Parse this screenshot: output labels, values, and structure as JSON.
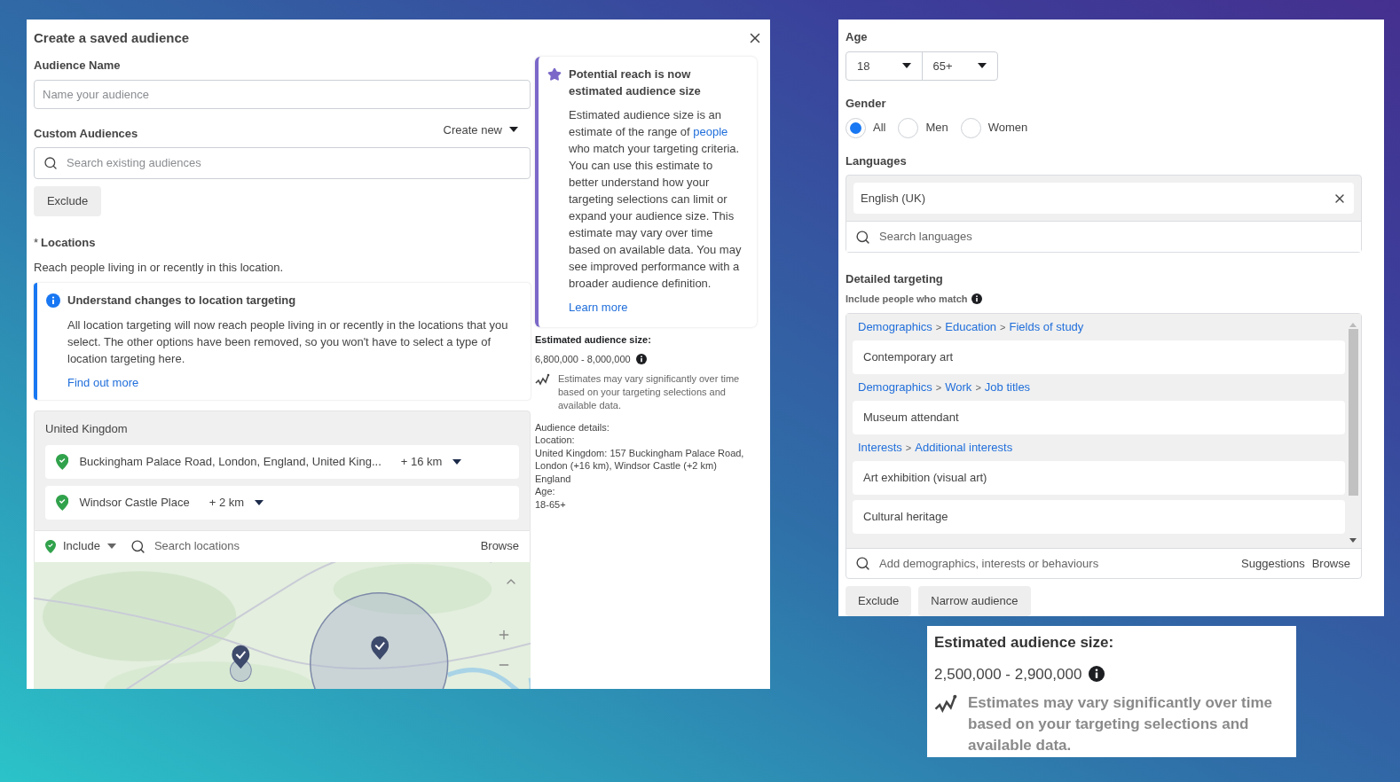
{
  "dialog": {
    "title": "Create a saved audience",
    "audience_name": {
      "label": "Audience Name",
      "placeholder": "Name your audience"
    },
    "custom_audiences": {
      "label": "Custom Audiences",
      "create_new": "Create new",
      "search_placeholder": "Search existing audiences",
      "exclude_button": "Exclude"
    },
    "locations": {
      "required_mark": "*",
      "label": "Locations",
      "description": "Reach people living in or recently in this location.",
      "notice": {
        "title": "Understand changes to location targeting",
        "body": "All location targeting will now reach people living in or recently in the locations that you select. The other options have been removed, so you won't have to select a type of location targeting here.",
        "link": "Find out more"
      },
      "country": "United Kingdom",
      "items": [
        {
          "name": "Buckingham Palace Road, London, England, United King...",
          "radius": "+ 16 km"
        },
        {
          "name": "Windsor Castle Place",
          "radius": "+ 2 km"
        }
      ],
      "include": "Include",
      "search_placeholder": "Search locations",
      "browse": "Browse"
    },
    "info_card": {
      "title": "Potential reach is now estimated audience size",
      "body_before": "Estimated audience size is an estimate of the range of",
      "body_link": "people",
      "body_after": "who match your targeting criteria. You can use this estimate to better understand how your targeting selections can limit or expand your audience size. This estimate may vary over time based on available data. You may see improved performance with a broader audience definition.",
      "link": "Learn more"
    },
    "estimate": {
      "label": "Estimated audience size:",
      "range": "6,800,000 - 8,000,000",
      "note": "Estimates may vary significantly over time based on your targeting selections and available data."
    },
    "audience_details": [
      "Audience details:",
      "Location:",
      "United Kingdom: 157 Buckingham Palace Road, London (+16 km), Windsor Castle (+2 km)",
      "England",
      "Age:",
      "18-65+"
    ]
  },
  "targeting_panel": {
    "age": {
      "label": "Age",
      "min": "18",
      "max": "65+"
    },
    "gender": {
      "label": "Gender",
      "options": [
        {
          "label": "All",
          "selected": true
        },
        {
          "label": "Men",
          "selected": false
        },
        {
          "label": "Women",
          "selected": false
        }
      ]
    },
    "languages": {
      "label": "Languages",
      "selected": [
        "English (UK)"
      ],
      "search_placeholder": "Search languages"
    },
    "detailed": {
      "label": "Detailed targeting",
      "sublabel": "Include people who match",
      "separator": ">",
      "groups": [
        {
          "path": [
            "Demographics",
            "Education",
            "Fields of study"
          ],
          "items": [
            "Contemporary art"
          ]
        },
        {
          "path": [
            "Demographics",
            "Work",
            "Job titles"
          ],
          "items": [
            "Museum attendant"
          ]
        },
        {
          "path": [
            "Interests",
            "Additional interests"
          ],
          "items": [
            "Art exhibition (visual art)",
            "Cultural heritage"
          ]
        }
      ],
      "search_placeholder": "Add demographics, interests or behaviours",
      "suggestions": "Suggestions",
      "browse": "Browse"
    },
    "buttons": [
      "Exclude",
      "Narrow audience"
    ]
  },
  "estimate_card": {
    "label": "Estimated audience size:",
    "range": "2,500,000 - 2,900,000",
    "note": "Estimates may vary significantly over time based on your targeting selections and available data."
  }
}
